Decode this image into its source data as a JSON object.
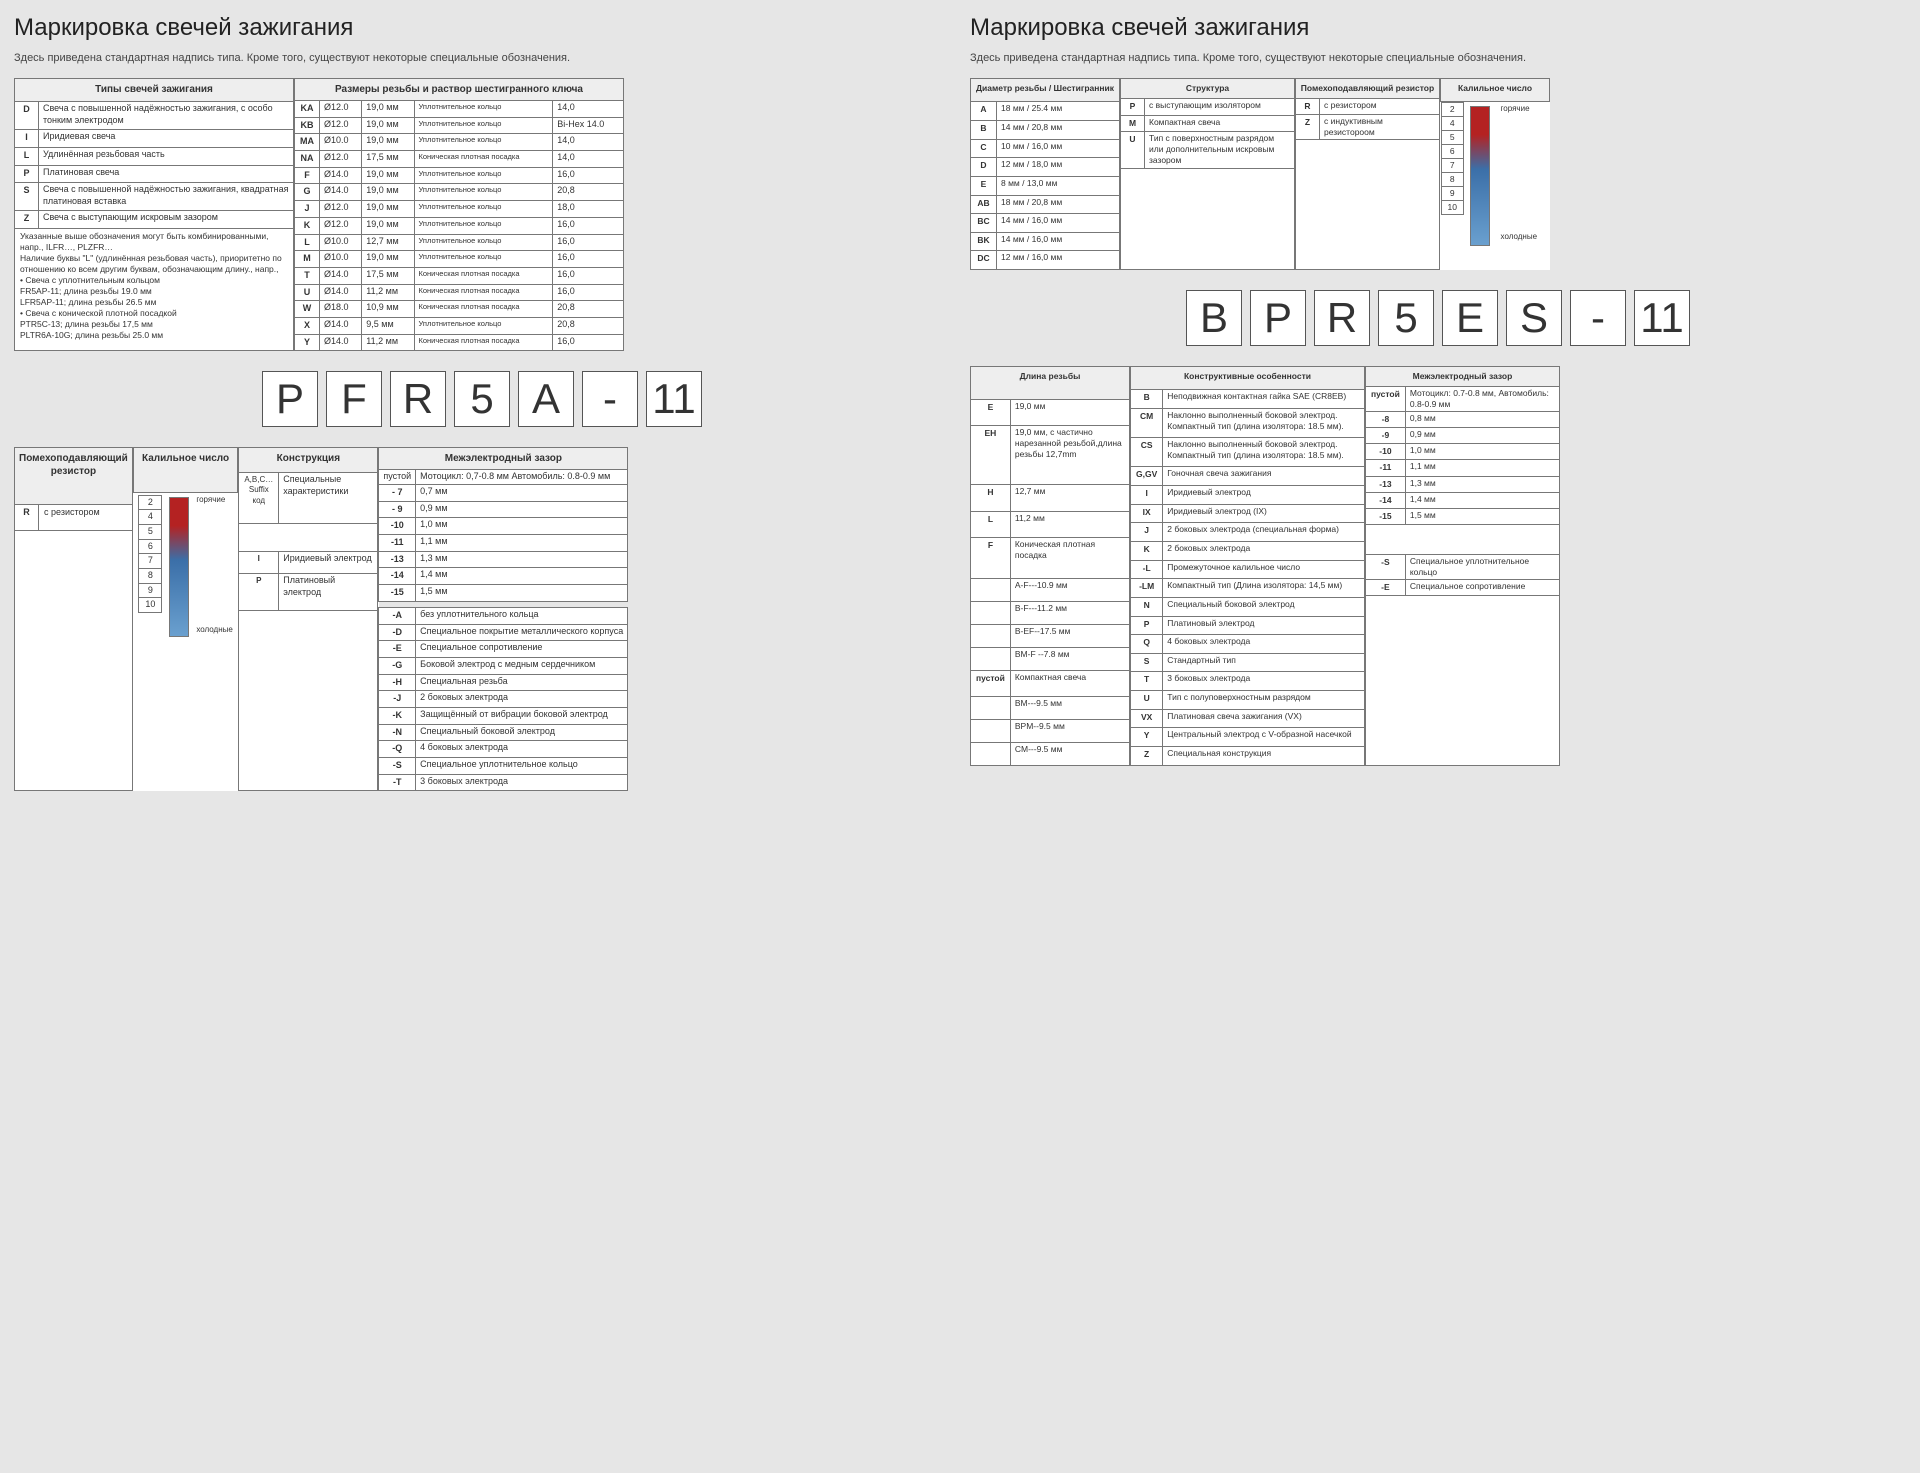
{
  "title": "Маркировка свечей зажигания",
  "subtitle": "Здесь приведена стандартная надпись типа. Кроме того, существуют некоторые специальные обозначения.",
  "code1": [
    "P",
    "F",
    "R",
    "5",
    "A",
    "-",
    "11"
  ],
  "code2": [
    "B",
    "P",
    "R",
    "5",
    "E",
    "S",
    "-",
    "11"
  ],
  "left": {
    "types": {
      "header": "Типы свечей зажигания",
      "rows": [
        [
          "D",
          "Свеча с повышенной надёжностью зажигания, с особо тонким электродом"
        ],
        [
          "I",
          "Иридиевая свеча"
        ],
        [
          "L",
          "Удлинённая резьбовая часть"
        ],
        [
          "P",
          "Платиновая свеча"
        ],
        [
          "S",
          "Свеча с повышенной надёжностью зажигания, квадратная платиновая вставка"
        ],
        [
          "Z",
          "Свеча с выступающим искровым зазором"
        ]
      ],
      "notes": [
        "Указанные выше обозначения могут быть комбинированными,",
        "напр., ILFR…, PLZFR…",
        "Наличие буквы \"L\" (удлинённая резьбовая часть), приоритетно по отношению ко всем другим буквам, обозначающим длину., напр.,",
        "• Свеча с уплотнительным кольцом",
        "  FR5AP-11; длина резьбы 19.0 мм",
        "  LFR5AP-11; длина резьбы 26.5 мм",
        "• Свеча с конической плотной посадкой",
        "  PTR5C-13; длина резьбы 17,5 мм",
        "  PLTR6A-10G; длина резьбы 25.0 мм"
      ]
    },
    "thread": {
      "header": "Размеры резьбы и раствор шестигранного ключа",
      "rows": [
        [
          "KA",
          "Ø12.0",
          "19,0 мм",
          "Уплотнительное кольцо",
          "14,0"
        ],
        [
          "KB",
          "Ø12.0",
          "19,0 мм",
          "Уплотнительное кольцо",
          "Bi-Hex 14.0"
        ],
        [
          "MA",
          "Ø10.0",
          "19,0 мм",
          "Уплотнительное кольцо",
          "14,0"
        ],
        [
          "NA",
          "Ø12.0",
          "17,5 мм",
          "Коническая плотная посадка",
          "14,0"
        ],
        [
          "F",
          "Ø14.0",
          "19,0 мм",
          "Уплотнительное кольцо",
          "16,0"
        ],
        [
          "G",
          "Ø14.0",
          "19,0 мм",
          "Уплотнительное кольцо",
          "20,8"
        ],
        [
          "J",
          "Ø12.0",
          "19,0 мм",
          "Уплотнительное кольцо",
          "18,0"
        ],
        [
          "K",
          "Ø12.0",
          "19,0 мм",
          "Уплотнительное кольцо",
          "16,0"
        ],
        [
          "L",
          "Ø10.0",
          "12,7 мм",
          "Уплотнительное кольцо",
          "16,0"
        ],
        [
          "M",
          "Ø10.0",
          "19,0 мм",
          "Уплотнительное кольцо",
          "16,0"
        ],
        [
          "T",
          "Ø14.0",
          "17,5 мм",
          "Коническая плотная посадка",
          "16,0"
        ],
        [
          "U",
          "Ø14.0",
          "11,2 мм",
          "Коническая плотная посадка",
          "16,0"
        ],
        [
          "W",
          "Ø18.0",
          "10,9 мм",
          "Коническая плотная посадка",
          "20,8"
        ],
        [
          "X",
          "Ø14.0",
          "9,5 мм",
          "Уплотнительное кольцо",
          "20,8"
        ],
        [
          "Y",
          "Ø14.0",
          "11,2 мм",
          "Коническая плотная посадка",
          "16,0"
        ]
      ]
    },
    "resistor": {
      "header": "Помехоподавляющий резистор",
      "row": [
        "R",
        "с резистором"
      ]
    },
    "heat": {
      "header": "Калильное число",
      "hot": "горячие",
      "cold": "холодные",
      "nums": [
        "2",
        "4",
        "5",
        "6",
        "7",
        "8",
        "9",
        "10"
      ]
    },
    "construction": {
      "header": "Конструкция",
      "rows": [
        [
          "A,B,C…\nSuffix код",
          "Специальные характеристики"
        ],
        [
          "I",
          "Иридиевый электрод"
        ],
        [
          "P",
          "Платиновый электрод"
        ]
      ]
    },
    "gap": {
      "header": "Межэлектродный зазор",
      "top": [
        "пустой",
        "Мотоцикл: 0,7-0.8 мм Автомобиль: 0.8-0.9 мм"
      ],
      "rows": [
        [
          "- 7",
          "0,7 мм"
        ],
        [
          "- 9",
          "0,9 мм"
        ],
        [
          "-10",
          "1,0 мм"
        ],
        [
          "-11",
          "1,1 мм"
        ],
        [
          "-13",
          "1,3 мм"
        ],
        [
          "-14",
          "1,4 мм"
        ],
        [
          "-15",
          "1,5 мм"
        ]
      ],
      "suffix": [
        [
          "-A",
          "без уплотнительного кольца"
        ],
        [
          "-D",
          "Специальное покрытие металлического корпуса"
        ],
        [
          "-E",
          "Специальное сопротивление"
        ],
        [
          "-G",
          "Боковой электрод с медным сердечником"
        ],
        [
          "-H",
          "Специальная резьба"
        ],
        [
          "-J",
          "2 боковых электрода"
        ],
        [
          "-K",
          "Защищённый от вибрации боковой электрод"
        ],
        [
          "-N",
          "Специальный боковой электрод"
        ],
        [
          "-Q",
          "4 боковых электрода"
        ],
        [
          "-S",
          "Специальное уплотнительное кольцо"
        ],
        [
          "-T",
          "3 боковых электрода"
        ]
      ]
    }
  },
  "right": {
    "thread": {
      "header": "Диаметр резьбы / Шестигранник",
      "rows": [
        [
          "A",
          "18 мм / 25.4 мм"
        ],
        [
          "B",
          "14 мм / 20,8 мм"
        ],
        [
          "C",
          "10 мм / 16,0 мм"
        ],
        [
          "D",
          "12 мм / 18,0 мм"
        ],
        [
          "E",
          "8 мм / 13,0 мм"
        ],
        [
          "AB",
          "18 мм / 20,8 мм"
        ],
        [
          "BC",
          "14 мм / 16,0 мм"
        ],
        [
          "BK",
          "14 мм / 16,0 мм"
        ],
        [
          "DC",
          "12 мм / 16,0 мм"
        ]
      ]
    },
    "structure": {
      "header": "Структура",
      "rows": [
        [
          "P",
          "с выступающим изолятором"
        ],
        [
          "M",
          "Компактная свеча"
        ],
        [
          "U",
          "Тип с поверхностным разрядом или дополнительным искровым зазором"
        ]
      ]
    },
    "resistor": {
      "header": "Помехоподавляющий резистор",
      "rows": [
        [
          "R",
          "с резистором"
        ],
        [
          "Z",
          "с индуктивным резистороом"
        ]
      ]
    },
    "heat": {
      "header": "Калильное число",
      "hot": "горячие",
      "cold": "холодные",
      "nums": [
        "2",
        "4",
        "5",
        "6",
        "7",
        "8",
        "9",
        "10"
      ]
    },
    "length": {
      "header": "Длина резьбы",
      "rows": [
        [
          "E",
          "19,0 мм"
        ],
        [
          "EH",
          "19,0 мм, с частично нарезанной резьбой,длина резьбы 12,7mm"
        ],
        [
          "H",
          "12,7 мм"
        ],
        [
          "L",
          "11,2 мм"
        ],
        [
          "F",
          "Коническая плотная посадка"
        ],
        [
          "",
          "A-F---10.9 мм"
        ],
        [
          "",
          "B-F---11.2 мм"
        ],
        [
          "",
          "B-EF--17.5 мм"
        ],
        [
          "",
          "BM-F --7.8 мм"
        ],
        [
          "пустой",
          "Компактная свеча"
        ],
        [
          "",
          "BM---9.5 мм"
        ],
        [
          "",
          "BPM--9.5 мм"
        ],
        [
          "",
          "CM---9.5 мм"
        ]
      ]
    },
    "features": {
      "header": "Конструктивные особенности",
      "rows": [
        [
          "B",
          "Неподвижная контактная гайка SAE (CR8EB)"
        ],
        [
          "CM",
          "Наклонно выполненный боковой электрод. Компактный тип (длина изолятора: 18.5 мм)."
        ],
        [
          "CS",
          "Наклонно выполненный боковой электрод. Компактный тип (длина изолятора: 18.5 мм)."
        ],
        [
          "G,GV",
          "Гоночная свеча зажигания"
        ],
        [
          "I",
          "Иридиевый электрод"
        ],
        [
          "IX",
          "Иридиевый электрод (IX)"
        ],
        [
          "J",
          "2 боковых электрода (специальная форма)"
        ],
        [
          "K",
          "2 боковых электрода"
        ],
        [
          "-L",
          "Промежуточное калильное число"
        ],
        [
          "-LM",
          "Компактный тип (Длина изолятора: 14,5 мм)"
        ],
        [
          "N",
          "Специальный боковой электрод"
        ],
        [
          "P",
          "Платиновый электрод"
        ],
        [
          "Q",
          "4 боковых электрода"
        ],
        [
          "S",
          "Стандартный тип"
        ],
        [
          "T",
          "3 боковых электрода"
        ],
        [
          "U",
          "Тип с полуповерхностным разрядом"
        ],
        [
          "VX",
          "Платиновая свеча зажигания (VX)"
        ],
        [
          "Y",
          "Центральный электрод с V-образной насечкой"
        ],
        [
          "Z",
          "Специальная конструкция"
        ]
      ]
    },
    "gap": {
      "header": "Межэлектродный зазор",
      "rows": [
        [
          "пустой",
          "Мотоцикл: 0.7-0.8 мм, Автомобиль: 0.8-0.9 мм"
        ],
        [
          "-8",
          "0,8 мм"
        ],
        [
          "-9",
          "0,9 мм"
        ],
        [
          "-10",
          "1,0 мм"
        ],
        [
          "-11",
          "1,1 мм"
        ],
        [
          "-13",
          "1,3 мм"
        ],
        [
          "-14",
          "1,4 мм"
        ],
        [
          "-15",
          "1,5 мм"
        ]
      ],
      "extra": [
        [
          "-S",
          "Специальное уплотнительное кольцо"
        ],
        [
          "-E",
          "Специальное сопротивление"
        ]
      ]
    }
  }
}
